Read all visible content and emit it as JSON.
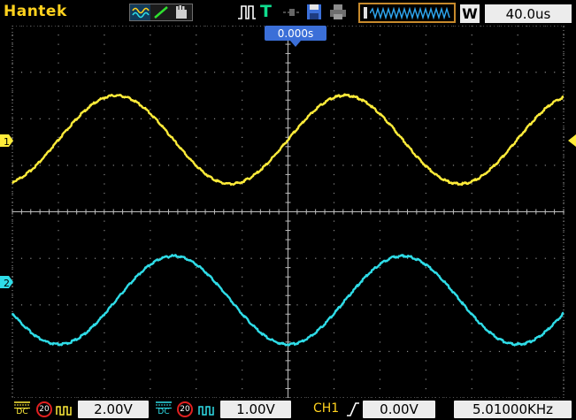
{
  "app": {
    "brand": "Hantek"
  },
  "top_bar": {
    "acquisition_icons": [
      "waveform-icon",
      "line-icon",
      "hand-icon"
    ],
    "trigger_label": "T",
    "memory_badge": "W",
    "timebase": "40.0us"
  },
  "display": {
    "trigger_position": "0.000s",
    "ch1_marker": "1",
    "ch2_marker": "2"
  },
  "bottom_bar": {
    "ch1": {
      "coupling": "DC",
      "bw_limit": "20",
      "scale": "2.00V"
    },
    "ch2": {
      "coupling": "DC",
      "bw_limit": "20",
      "scale": "1.00V"
    },
    "trigger": {
      "source": "CH1",
      "level": "0.00V",
      "frequency": "5.01000KHz"
    }
  },
  "colors": {
    "ch1": "#ffec3a",
    "ch2": "#2fdde8",
    "grid": "#8a8a8a",
    "trigger_marker": "#3b6fd8",
    "brand": "#ffd21e"
  },
  "chart_data": {
    "type": "line",
    "title": "",
    "xlabel": "",
    "ylabel": "",
    "grid": true,
    "x_divisions": 12,
    "y_divisions": 8,
    "series": [
      {
        "channel": "CH1",
        "type": "sine",
        "frequency_hz": 5010,
        "amplitude_div": 0.95,
        "offset_div": 1.55,
        "color": "#ffec3a"
      },
      {
        "channel": "CH2",
        "type": "sine",
        "frequency_hz": 5010,
        "amplitude_div": 0.95,
        "offset_div": -1.9,
        "color": "#2fdde8"
      }
    ]
  }
}
